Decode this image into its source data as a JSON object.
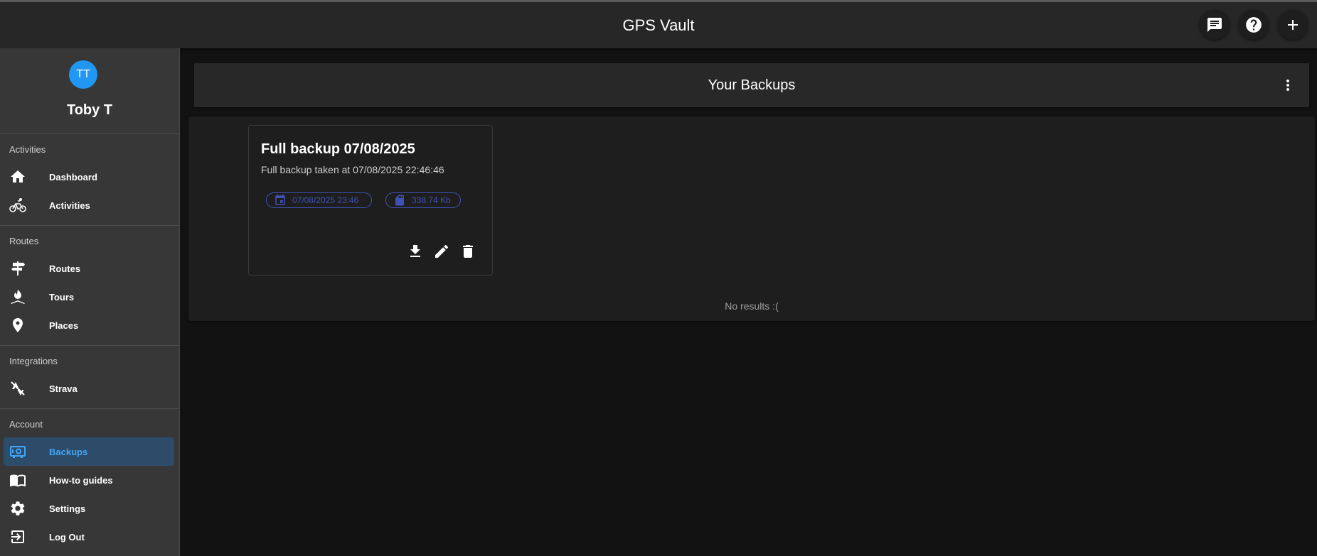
{
  "appbar": {
    "title": "GPS Vault",
    "buttons": [
      {
        "icon": "feedback-icon"
      },
      {
        "icon": "help-icon"
      },
      {
        "icon": "add-icon"
      }
    ]
  },
  "drawer": {
    "avatar_initials": "TT",
    "avatar_color": "#2196f3",
    "user_name": "Toby T",
    "sections": [
      {
        "label": "Activities",
        "items": [
          {
            "label": "Dashboard",
            "icon": "home-icon"
          },
          {
            "label": "Activities",
            "icon": "bike-icon"
          }
        ]
      },
      {
        "label": "Routes",
        "items": [
          {
            "label": "Routes",
            "icon": "signpost-icon"
          },
          {
            "label": "Tours",
            "icon": "campfire-icon"
          },
          {
            "label": "Places",
            "icon": "place-icon"
          }
        ]
      },
      {
        "label": "Integrations",
        "items": [
          {
            "label": "Strava",
            "icon": "strava-icon"
          }
        ]
      },
      {
        "label": "Account",
        "items": [
          {
            "label": "Backups",
            "icon": "backup-safe-icon",
            "active": true
          },
          {
            "label": "How-to guides",
            "icon": "book-icon"
          },
          {
            "label": "Settings",
            "icon": "gear-icon"
          },
          {
            "label": "Log Out",
            "icon": "logout-icon"
          }
        ]
      }
    ],
    "active_color": "#42a5f5"
  },
  "main": {
    "title": "Your Backups",
    "backups": [
      {
        "title": "Full backup 07/08/2025",
        "subtitle": "Full backup taken at 07/08/2025 22:46:46",
        "date_chip": "07/08/2025 23:46",
        "size_chip": "338.74 Kb",
        "chip_color": "#3f51b5"
      }
    ],
    "no_results": "No results :("
  }
}
